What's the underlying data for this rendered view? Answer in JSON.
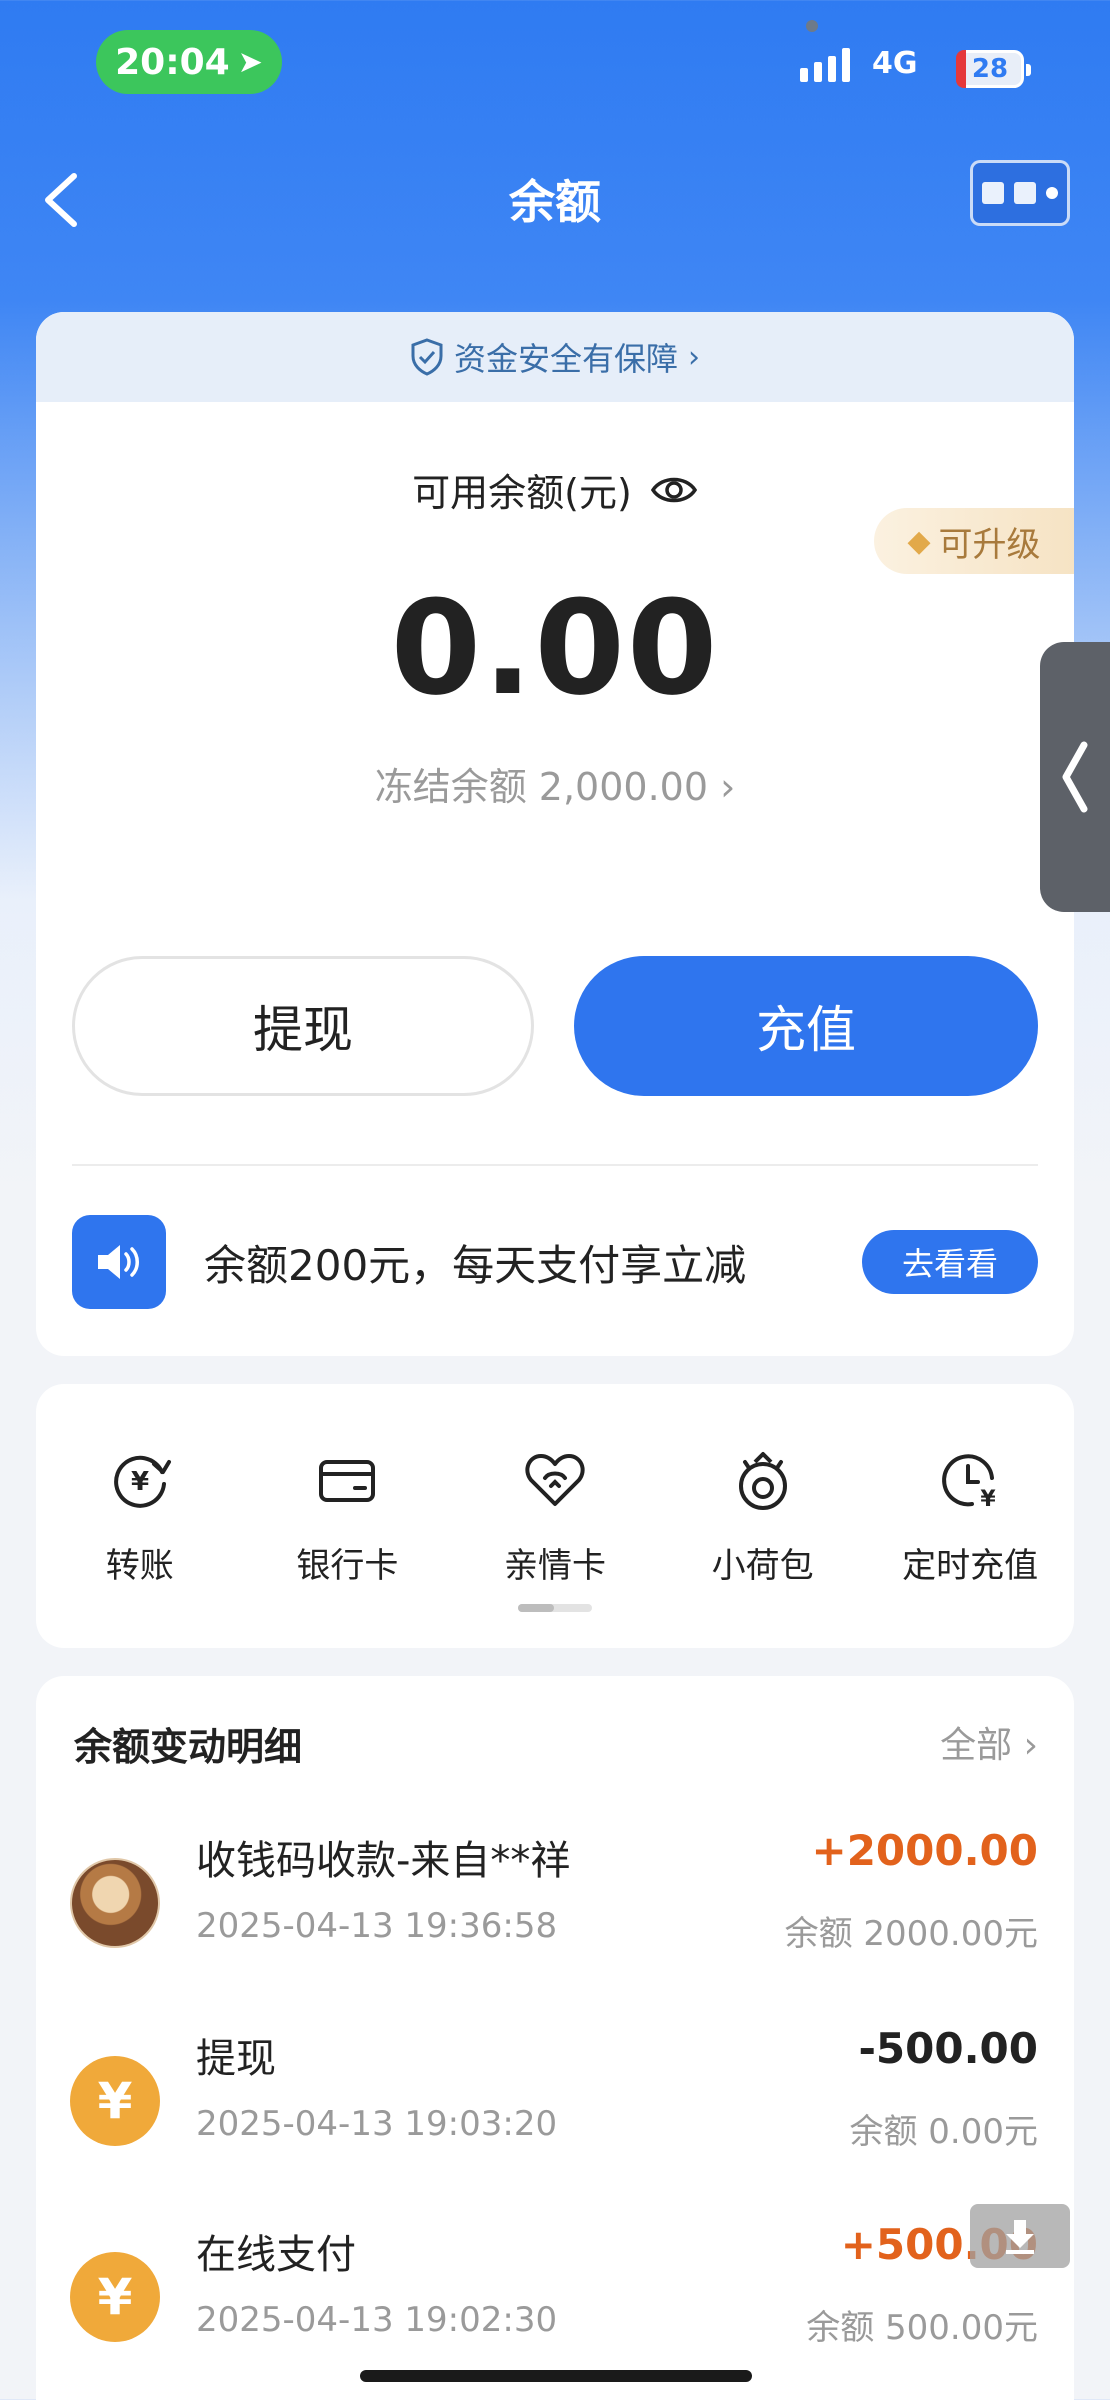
{
  "status_bar": {
    "time": "20:04",
    "network": "4G",
    "battery": "28"
  },
  "nav": {
    "title": "余额",
    "back_icon": "chevron-left-icon",
    "more_icon": "mini-program-menu-icon"
  },
  "balance": {
    "safety_text": "资金安全有保障",
    "available_label": "可用余额(元)",
    "amount": "0.00",
    "upgrade_label": "可升级",
    "frozen_label": "冻结余额",
    "frozen_amount": "2,000.00",
    "withdraw_label": "提现",
    "recharge_label": "充值"
  },
  "promo": {
    "text": "余额200元，每天支付享立减",
    "button_label": "去看看"
  },
  "actions": [
    {
      "label": "转账",
      "icon": "transfer-icon"
    },
    {
      "label": "银行卡",
      "icon": "bank-card-icon"
    },
    {
      "label": "亲情卡",
      "icon": "family-card-icon"
    },
    {
      "label": "小荷包",
      "icon": "purse-icon"
    },
    {
      "label": "定时充值",
      "icon": "scheduled-recharge-icon"
    }
  ],
  "transactions": {
    "header": "余额变动明细",
    "all_label": "全部",
    "items": [
      {
        "title": "收钱码收款-来自**祥",
        "time": "2025-04-13 19:36:58",
        "amount": "+2000.00",
        "balance": "余额 2000.00元",
        "avatar": "photo"
      },
      {
        "title": "提现",
        "time": "2025-04-13 19:03:20",
        "amount": "-500.00",
        "balance": "余额 0.00元",
        "avatar": "yen"
      },
      {
        "title": "在线支付",
        "time": "2025-04-13 19:02:30",
        "amount": "+500.00",
        "balance": "余额 500.00元",
        "avatar": "yen"
      }
    ]
  },
  "colors": {
    "brand_blue": "#2f75ee",
    "income_orange": "#e2621c",
    "yen_orange": "#f0a93a"
  }
}
